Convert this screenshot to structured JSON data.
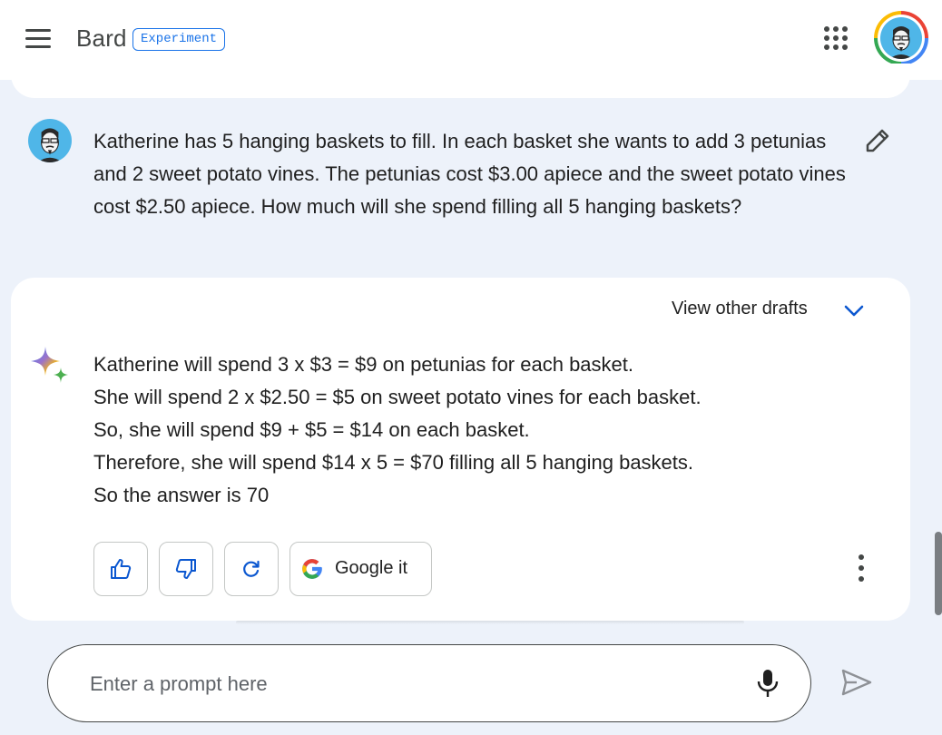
{
  "header": {
    "brand": "Bard",
    "badge": "Experiment",
    "icons": [
      "menu-icon",
      "apps-grid-icon",
      "account-avatar"
    ]
  },
  "conversation": {
    "user_prompt": "Katherine has 5 hanging baskets to fill. In each basket she wants to add 3 petunias and 2 sweet potato vines. The petunias cost $3.00 apiece and the sweet potato vines cost $2.50 apiece. How much will she spend filling all 5 hanging baskets?",
    "drafts_label": "View other drafts",
    "response_lines": [
      "Katherine will spend 3 x $3 = $9 on petunias for each basket.",
      "She will spend 2 x $2.50 = $5 on sweet potato vines for each basket.",
      "So, she will spend $9 + $5 = $14 on each basket.",
      "Therefore, she will spend $14 x 5 = $70 filling all 5 hanging baskets.",
      "So the answer is 70"
    ],
    "actions": {
      "google_it_label": "Google it",
      "icons": [
        "thumbs-up-icon",
        "thumbs-down-icon",
        "regenerate-icon",
        "google-g-icon",
        "more-vert-icon"
      ]
    }
  },
  "input": {
    "placeholder": "Enter a prompt here",
    "value": ""
  },
  "colors": {
    "background": "#edf2fa",
    "accent": "#1a73e8",
    "action_icon": "#0b57d0"
  }
}
